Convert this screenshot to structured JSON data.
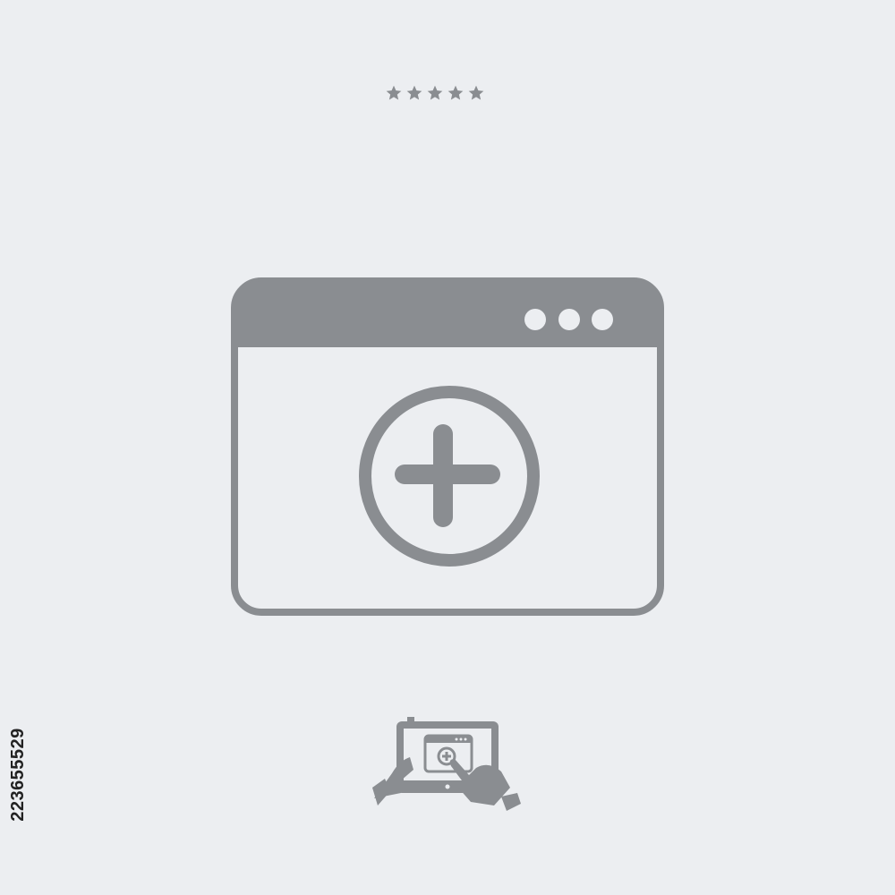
{
  "rating": {
    "stars": 5
  },
  "stock_id": "223655529",
  "colors": {
    "background": "#eceef1",
    "icon": "#8a8d91",
    "icon_light": "#eceef1"
  },
  "icons": {
    "main": "browser-window-add-icon",
    "bottom": "tablet-touch-add-icon"
  }
}
